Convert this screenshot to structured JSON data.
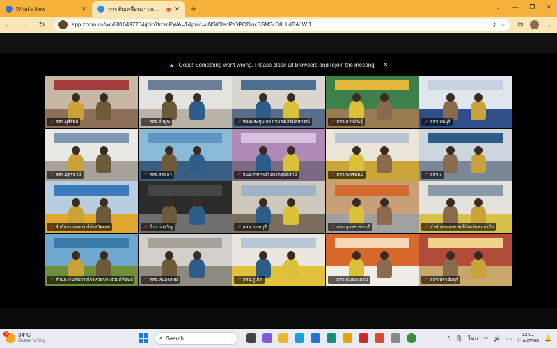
{
  "browser": {
    "tabs": [
      {
        "label": "What's New",
        "active": false
      },
      {
        "label": "การขับเคลื่อนงานและเฝ้าระวังการ",
        "active": true
      }
    ],
    "new_tab": "+",
    "url": "app.zoom.us/wc/8810497704/join?fromPWA=1&pwd=uNSlOleoPtOPODwcBSM3cD8LLdBAJW.1"
  },
  "meeting": {
    "error_message": "Oops! Something went wrong. Please close all browsers and rejoin the meeting.",
    "tiles": [
      {
        "name": "สสจ.บุรีรัมย์",
        "wall": "#c9b7a6",
        "floor": "#8d6f5a",
        "banner": "#a33b3b"
      },
      {
        "name": "สสจ.ลำพูน",
        "wall": "#e3e3df",
        "floor": "#b9b2a6",
        "banner": "#6b7e96"
      },
      {
        "name": "ห้องประชุม 03 กรมส่งเสริมสหกรณ์",
        "wall": "#d9d6cf",
        "floor": "#5a6e8c",
        "banner": "#4d6e8e"
      },
      {
        "name": "สสจ.กาฬสินธุ์",
        "wall": "#3f7f4a",
        "floor": "#9a7a4f",
        "banner": "#e3b93a"
      },
      {
        "name": "สสจ.ลพบุรี",
        "wall": "#dfe6ee",
        "floor": "#2f4f8a",
        "banner": "#c6d2e0"
      },
      {
        "name": "สสจ.อุดรธานี",
        "wall": "#e9e9e6",
        "floor": "#a8a29a",
        "banner": "#7f97b3"
      },
      {
        "name": "สสจ.สงขลา",
        "wall": "#8bbad6",
        "floor": "#3a5e82",
        "banner": "#5f94c0"
      },
      {
        "name": "สนง.สหกรณ์จังหวัดอุทัยธานี",
        "wall": "#b08ab7",
        "floor": "#7b6a84",
        "banner": "#d7c1dc"
      },
      {
        "name": "สสจ.นครพนม",
        "wall": "#ebe5d8",
        "floor": "#c9a53a",
        "banner": "#b8c6d4"
      },
      {
        "name": "สสจ.1",
        "wall": "#cdd5df",
        "floor": "#7a8796",
        "banner": "#2f5d8a"
      },
      {
        "name": "สำนักงานสหกรณ์จังหวัดเลย",
        "wall": "#b7cde0",
        "floor": "#e0a72e",
        "banner": "#3d7bbd"
      },
      {
        "name": "อำนาจเจริญ",
        "wall": "#2b2b2b",
        "floor": "#707070",
        "banner": "#444444"
      },
      {
        "name": "สสจ.นนทบุรี",
        "wall": "#cfc8bd",
        "floor": "#7a6f5f",
        "banner": "#9fb3c6"
      },
      {
        "name": "สสจ.อุบลราชธานี",
        "wall": "#c89f76",
        "floor": "#a0a0a0",
        "banner": "#d26a2e"
      },
      {
        "name": "สำนักงานสหกรณ์จังหวัดหนองบัว",
        "wall": "#e4e2dc",
        "floor": "#d8c14a",
        "banner": "#8a9aa8"
      },
      {
        "name": "สำนักงานสหกรณ์จังหวัดประจวบคีรีขันธ์",
        "wall": "#6fa8cf",
        "floor": "#6f8f3a",
        "banner": "#3a7aa8"
      },
      {
        "name": "สสจ.หนองคาย",
        "wall": "#d1d0cb",
        "floor": "#8e8a82",
        "banner": "#a7a39a"
      },
      {
        "name": "สสจ.ภูเก็ต",
        "wall": "#eae7e0",
        "floor": "#e2c23b",
        "banner": "#b7c7d6"
      },
      {
        "name": "สสจ.แม่ฮ่องสอน",
        "wall": "#d9682c",
        "floor": "#f0ede6",
        "banner": "#f6d7b8"
      },
      {
        "name": "สสจ.ปราจีนบุรี",
        "wall": "#b24b3a",
        "floor": "#c9a76a",
        "banner": "#f0d28a"
      }
    ]
  },
  "taskbar": {
    "weather": {
      "temp": "34°C",
      "desc": "มีแดดส่วนใหญ่",
      "badge": "3"
    },
    "search": "Search",
    "lang": "ไทย",
    "time": "12:01",
    "date": "21/4/2568"
  },
  "colors": {
    "chrome": "#f6b23a",
    "chrome_light": "#fbe6b8",
    "warning": "#f7c23c"
  }
}
